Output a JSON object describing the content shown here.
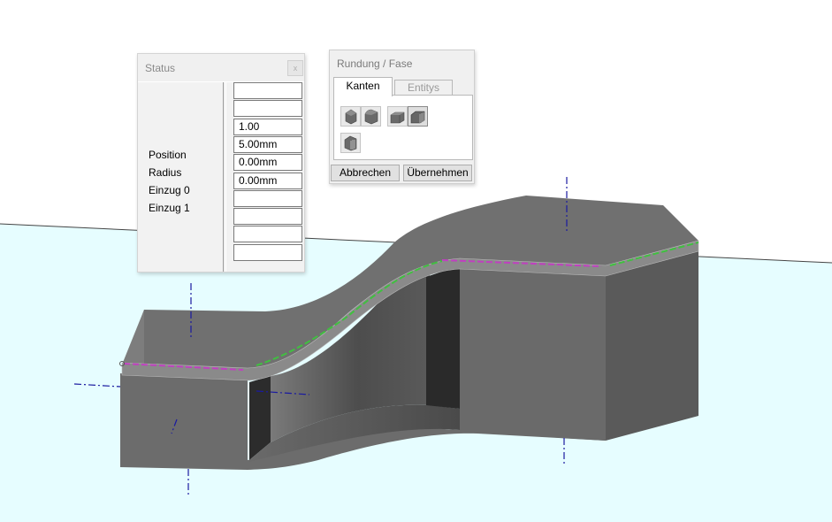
{
  "colors": {
    "floor": "#e6fdff",
    "horizon": "#444444",
    "model_face": "#696969",
    "fillet_highlight_magenta": "#c040c0",
    "fillet_highlight_green": "#40c040",
    "axis_marker": "#1a1aa0"
  },
  "status_panel": {
    "title": "Status",
    "close_glyph": "x",
    "labels": [
      "Position",
      "Radius",
      "Einzug 0",
      "Einzug 1"
    ],
    "fields": [
      "",
      "",
      "1.00",
      "5.00mm",
      "0.00mm",
      "0.00mm",
      "",
      "",
      "",
      ""
    ]
  },
  "fillet_panel": {
    "title": "Rundung / Fase",
    "tabs": [
      {
        "label": "Kanten",
        "active": true
      },
      {
        "label": "Entitys",
        "active": false
      }
    ],
    "tools": [
      "round-edge-icon",
      "round-edge-alt-icon",
      "chamfer-edge-icon",
      "chamfer-active-icon",
      "edge-select-icon"
    ],
    "buttons": {
      "cancel": "Abbrechen",
      "apply": "Übernehmen"
    }
  }
}
